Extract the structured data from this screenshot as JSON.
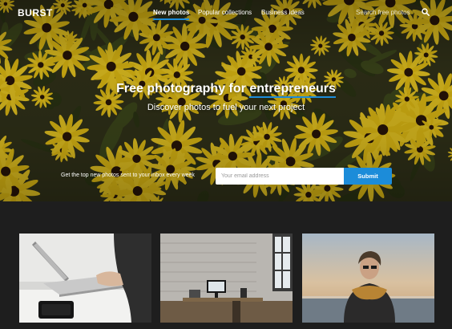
{
  "nav": {
    "logo": "BURST",
    "links": [
      {
        "label": "New photos",
        "active": true
      },
      {
        "label": "Popular collections",
        "active": false
      },
      {
        "label": "Business ideas",
        "active": false
      }
    ],
    "search_placeholder": "Search free photos",
    "search_icon": "search-icon"
  },
  "hero": {
    "title_main": "Free photography for ",
    "title_accent": "entrepreneurs",
    "subtitle": "Discover photos to fuel your next project",
    "signup_text": "Get the top new photos sent to your inbox every week",
    "email_placeholder": "Your email address",
    "submit_label": "Submit"
  },
  "colors": {
    "accent": "#1c8cd9",
    "page_bg": "#1e1e1e",
    "flower_yellow": "#e8c214",
    "flower_center": "#2a1608"
  },
  "gallery": {
    "photos": [
      {
        "subject": "laptop-and-speaker-photo"
      },
      {
        "subject": "desk-with-monitor-photo"
      },
      {
        "subject": "person-by-sea-photo"
      }
    ]
  }
}
